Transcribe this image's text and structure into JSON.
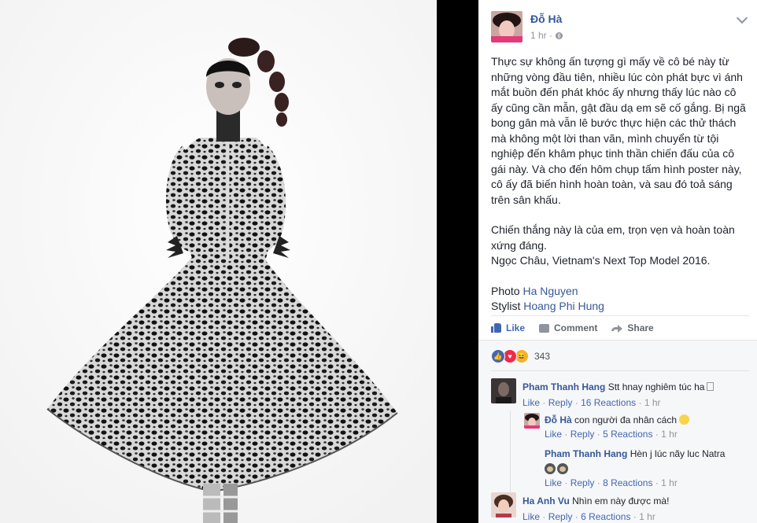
{
  "post": {
    "author": "Đỗ Hà",
    "time": "1 hr ·",
    "paragraph1": "Thực sự không ấn tượng gì mấy về cô bé này từ những vòng đầu tiên, nhiều lúc còn phát bực vì ánh mắt buồn đến phát khóc ấy nhưng thấy lúc nào cô ấy cũng cần mẫn, gật đầu dạ em sẽ cố gắng. Bị ngã bong gân mà vẫn lê bước thực hiện các thử thách mà không một lời than vãn, mình chuyển từ tội nghiệp đến khâm phục tinh thần chiến đấu của cô gái này. Và cho đến hôm chụp tấm hình poster này, cô ấy đã biến hình hoàn toàn, và sau đó toả sáng trên sân khấu.",
    "paragraph2_line1": "Chiến thắng này là của em, trọn vẹn và hoàn toàn xứng đáng.",
    "paragraph2_line2": "Ngọc Châu, Vietnam's Next Top Model 2016.",
    "photo_label": "Photo",
    "photo_credit": "Ha Nguyen",
    "stylist_label": "Stylist",
    "stylist_credit": "Hoang Phi Hung"
  },
  "actions": {
    "like": "Like",
    "comment": "Comment",
    "share": "Share"
  },
  "reactions": {
    "count": "343",
    "types": [
      "like",
      "love",
      "haha"
    ]
  },
  "comments": [
    {
      "name": "Pham Thanh Hang",
      "text": "Stt hnay nghiêm túc ha",
      "like": "Like",
      "reply": "Reply",
      "reactions": "16 Reactions",
      "time": "1 hr"
    },
    {
      "name": "Đỗ Hà",
      "text": "con người đa nhân cách",
      "like": "Like",
      "reply": "Reply",
      "reactions": "5 Reactions",
      "time": "1 hr"
    },
    {
      "name": "Pham Thanh Hang",
      "text": "Hèn j lúc nãy luc Natra",
      "like": "Like",
      "reply": "Reply",
      "reactions": "8 Reactions",
      "time": "1 hr"
    },
    {
      "name": "Ha Anh Vu",
      "text": "Nhìn em này được mà!",
      "like": "Like",
      "reply": "Reply",
      "reactions": "6 Reactions",
      "time": "1 hr"
    }
  ],
  "colors": {
    "link": "#365899",
    "accent": "#4267b2",
    "muted": "#90949c"
  }
}
